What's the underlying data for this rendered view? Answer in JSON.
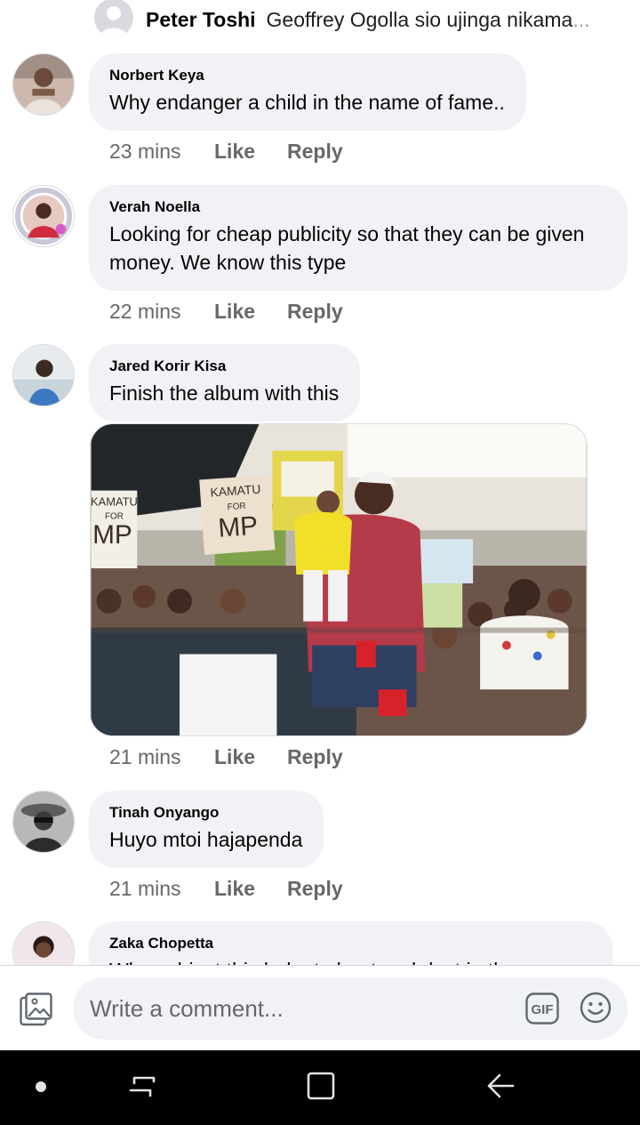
{
  "top_reply": {
    "name": "Peter Toshi",
    "text": "Geoffrey Ogolla sio ujinga nikama",
    "ellipsis": "..."
  },
  "comments": [
    {
      "name": "Norbert Keya",
      "lines": [
        "Why endanger a child in the name of fame.."
      ],
      "time": "23 mins",
      "like": "Like",
      "reply": "Reply"
    },
    {
      "name": "Verah Noella",
      "lines": [
        "Looking for cheap publicity so that they can be given",
        "money. We know this type"
      ],
      "time": "22 mins",
      "like": "Like",
      "reply": "Reply"
    },
    {
      "name": "Jared Korir Kisa",
      "lines": [
        "Finish the  album with this"
      ],
      "time": "21 mins",
      "like": "Like",
      "reply": "Reply"
    },
    {
      "name": "Tinah Onyango",
      "lines": [
        "Huyo mtoi hajapenda"
      ],
      "time": "21 mins",
      "like": "Like",
      "reply": "Reply"
    },
    {
      "name": "Zaka Chopetta",
      "lines": [
        "Why subject this baby to heat and dust in the"
      ]
    }
  ],
  "photo": {
    "sign_left": [
      "KAMATU",
      "FOR",
      "MP"
    ],
    "sign_right": [
      "KAMATU",
      "FOR",
      "MP"
    ]
  },
  "composer": {
    "placeholder": "Write a comment...",
    "gif_label": "GIF"
  },
  "icons": {
    "gallery": "photo-gallery-icon",
    "gif": "gif-icon",
    "emoji": "smiley-icon",
    "nav_recent": "recent-apps-icon",
    "nav_home": "home-icon",
    "nav_back": "back-icon"
  },
  "colors": {
    "bubble": "#f0f2f5",
    "meta": "#65676b",
    "navbar": "#000000"
  }
}
